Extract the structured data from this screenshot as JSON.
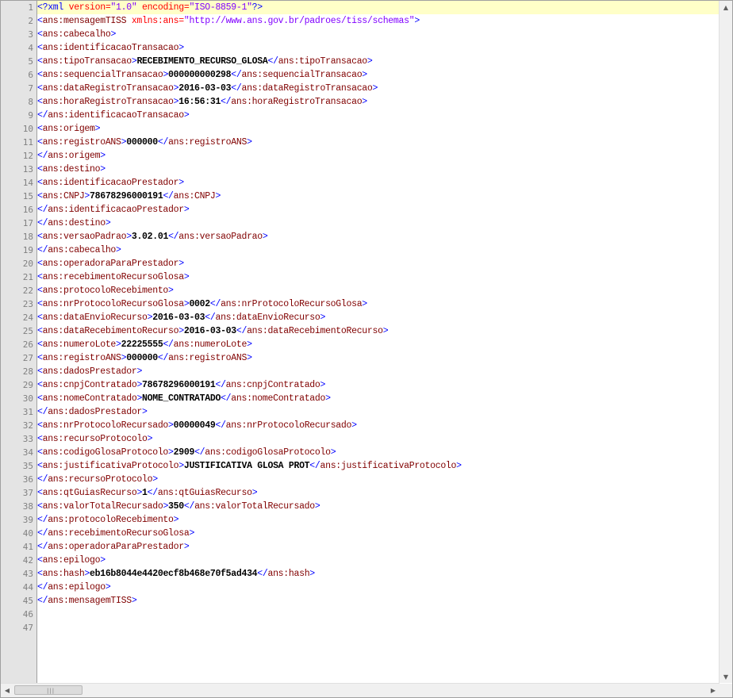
{
  "editor": {
    "current_line": 1,
    "line_numbers": [
      "1",
      "2",
      "3",
      "4",
      "5",
      "6",
      "7",
      "8",
      "9",
      "10",
      "11",
      "12",
      "13",
      "14",
      "15",
      "16",
      "17",
      "18",
      "19",
      "20",
      "21",
      "22",
      "23",
      "24",
      "25",
      "26",
      "27",
      "28",
      "29",
      "30",
      "31",
      "32",
      "33",
      "34",
      "35",
      "36",
      "37",
      "38",
      "39",
      "40",
      "41",
      "42",
      "43",
      "44",
      "45",
      "46",
      "47"
    ],
    "xml_decl": {
      "open": "<?xml ",
      "version_attr": "version=",
      "version_val": "\"1.0\"",
      "encoding_attr": " encoding=",
      "encoding_val": "\"ISO-8859-1\"",
      "close": "?>"
    },
    "root_open": {
      "tag": "ans:mensagemTISS",
      "attr": " xmlns:ans=",
      "attr_val": "\"http://www.ans.gov.br/padroes/tiss/schemas\""
    },
    "lines": [
      {
        "kind": "open",
        "tag": "ans:cabecalho"
      },
      {
        "kind": "open",
        "tag": "ans:identificacaoTransacao"
      },
      {
        "kind": "elem",
        "tag": "ans:tipoTransacao",
        "text": "RECEBIMENTO_RECURSO_GLOSA"
      },
      {
        "kind": "elem",
        "tag": "ans:sequencialTransacao",
        "text": "000000000298"
      },
      {
        "kind": "elem",
        "tag": "ans:dataRegistroTransacao",
        "text": "2016-03-03"
      },
      {
        "kind": "elem",
        "tag": "ans:horaRegistroTransacao",
        "text": "16:56:31"
      },
      {
        "kind": "close",
        "tag": "ans:identificacaoTransacao"
      },
      {
        "kind": "open",
        "tag": "ans:origem"
      },
      {
        "kind": "elem",
        "tag": "ans:registroANS",
        "text": "000000"
      },
      {
        "kind": "close",
        "tag": "ans:origem"
      },
      {
        "kind": "open",
        "tag": "ans:destino"
      },
      {
        "kind": "open",
        "tag": "ans:identificacaoPrestador"
      },
      {
        "kind": "elem",
        "tag": "ans:CNPJ",
        "text": "78678296000191"
      },
      {
        "kind": "close",
        "tag": "ans:identificacaoPrestador"
      },
      {
        "kind": "close",
        "tag": "ans:destino"
      },
      {
        "kind": "elem",
        "tag": "ans:versaoPadrao",
        "text": "3.02.01"
      },
      {
        "kind": "close",
        "tag": "ans:cabecalho"
      },
      {
        "kind": "open",
        "tag": "ans:operadoraParaPrestador"
      },
      {
        "kind": "open",
        "tag": "ans:recebimentoRecursoGlosa"
      },
      {
        "kind": "open",
        "tag": "ans:protocoloRecebimento"
      },
      {
        "kind": "elem",
        "tag": "ans:nrProtocoloRecursoGlosa",
        "text": "0002"
      },
      {
        "kind": "elem",
        "tag": "ans:dataEnvioRecurso",
        "text": "2016-03-03"
      },
      {
        "kind": "elem",
        "tag": "ans:dataRecebimentoRecurso",
        "text": "2016-03-03"
      },
      {
        "kind": "elem",
        "tag": "ans:numeroLote",
        "text": "22225555"
      },
      {
        "kind": "elem",
        "tag": "ans:registroANS",
        "text": "000000"
      },
      {
        "kind": "open",
        "tag": "ans:dadosPrestador"
      },
      {
        "kind": "elem",
        "tag": "ans:cnpjContratado",
        "text": "78678296000191"
      },
      {
        "kind": "elem",
        "tag": "ans:nomeContratado",
        "text": "NOME_CONTRATADO"
      },
      {
        "kind": "close",
        "tag": "ans:dadosPrestador"
      },
      {
        "kind": "elem",
        "tag": "ans:nrProtocoloRecursado",
        "text": "00000049"
      },
      {
        "kind": "open",
        "tag": "ans:recursoProtocolo"
      },
      {
        "kind": "elem",
        "tag": "ans:codigoGlosaProtocolo",
        "text": "2909"
      },
      {
        "kind": "elem",
        "tag": "ans:justificativaProtocolo",
        "text": "JUSTIFICATIVA GLOSA PROT"
      },
      {
        "kind": "close",
        "tag": "ans:recursoProtocolo"
      },
      {
        "kind": "elem",
        "tag": "ans:qtGuiasRecurso",
        "text": "1"
      },
      {
        "kind": "elem",
        "tag": "ans:valorTotalRecursado",
        "text": "350"
      },
      {
        "kind": "close",
        "tag": "ans:protocoloRecebimento"
      },
      {
        "kind": "close",
        "tag": "ans:recebimentoRecursoGlosa"
      },
      {
        "kind": "close",
        "tag": "ans:operadoraParaPrestador"
      },
      {
        "kind": "open",
        "tag": "ans:epilogo"
      },
      {
        "kind": "elem",
        "tag": "ans:hash",
        "text": "eb16b8044e4420ecf8b468e70f5ad434"
      },
      {
        "kind": "close",
        "tag": "ans:epilogo"
      },
      {
        "kind": "close",
        "tag": "ans:mensagemTISS"
      }
    ],
    "scroll_icons": {
      "up": "scroll-up-arrow-icon",
      "down": "scroll-down-arrow-icon",
      "left": "scroll-left-arrow-icon",
      "right": "scroll-right-arrow-icon"
    },
    "colors": {
      "tag": "#800000",
      "bracket": "#0000ff",
      "attr": "#ff0000",
      "value": "#8000ff",
      "text": "#000000",
      "current_line": "#ffffc8",
      "gutter": "#e4e4e4"
    }
  }
}
